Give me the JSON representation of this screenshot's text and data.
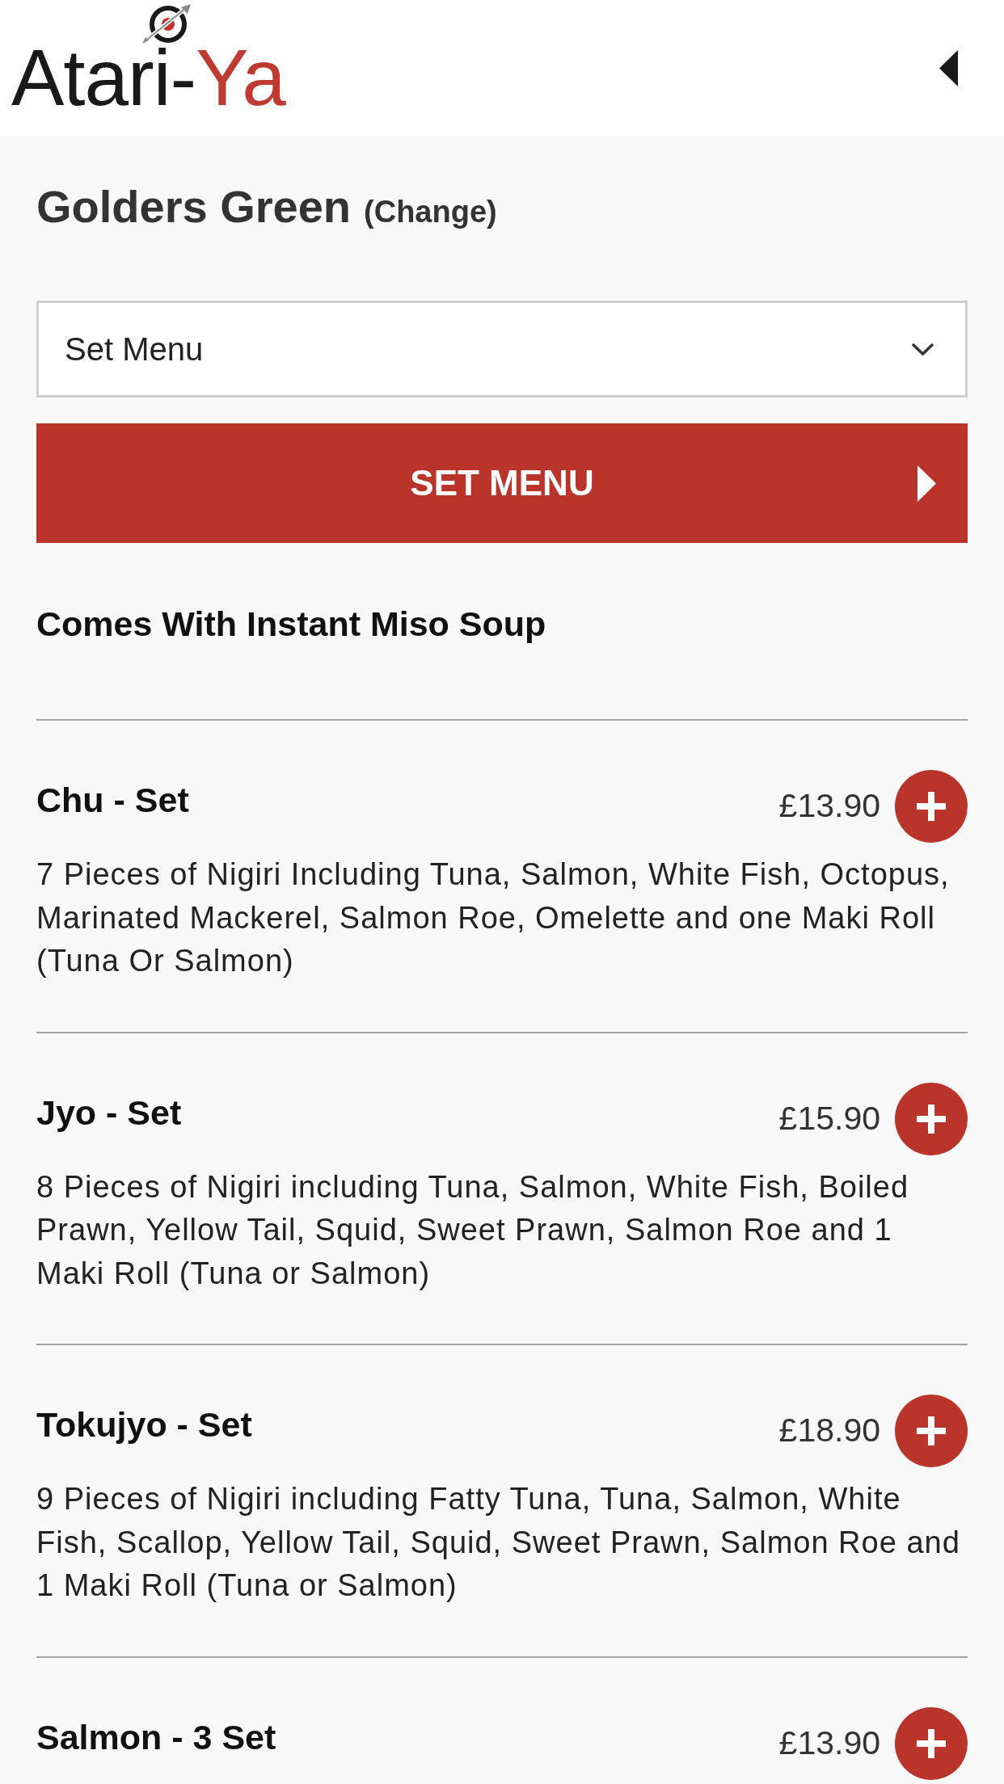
{
  "header": {
    "logo": {
      "parts": [
        {
          "text": "Atari-",
          "color": "#1a1a1a"
        },
        {
          "text": "Ya",
          "color": "#bf3a30"
        }
      ]
    }
  },
  "location": {
    "name": "Golders Green",
    "change_link": "(Change)"
  },
  "category_select": {
    "value": "Set Menu"
  },
  "section": {
    "title": "SET MENU",
    "note": "Comes With Instant Miso Soup"
  },
  "items": [
    {
      "name": "Chu - Set",
      "price": "£13.90",
      "description": "7 Pieces of Nigiri Including Tuna, Salmon, White Fish, Octopus, Marinated Mackerel, Salmon Roe, Omelette and one Maki Roll (Tuna Or Salmon)"
    },
    {
      "name": "Jyo - Set",
      "price": "£15.90",
      "description": "8 Pieces of Nigiri including Tuna, Salmon, White Fish, Boiled Prawn, Yellow Tail, Squid, Sweet Prawn, Salmon Roe and 1 Maki Roll (Tuna or Salmon)"
    },
    {
      "name": "Tokujyo - Set",
      "price": "£18.90",
      "description": "9 Pieces of Nigiri including Fatty Tuna, Tuna, Salmon, White Fish, Scallop, Yellow Tail, Squid, Sweet Prawn, Salmon Roe and 1 Maki Roll (Tuna or Salmon)"
    },
    {
      "name": "Salmon - 3 Set",
      "price": "£13.90"
    }
  ]
}
